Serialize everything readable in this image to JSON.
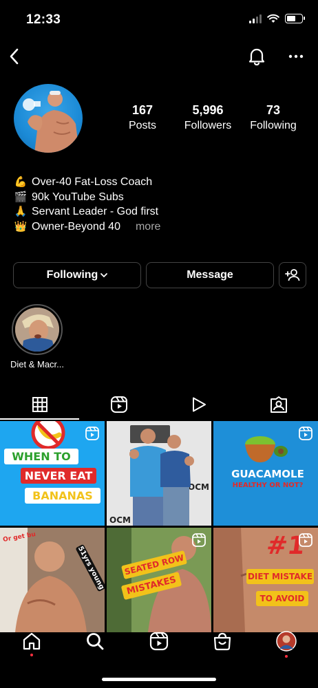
{
  "status_bar": {
    "time": "12:33"
  },
  "profile": {
    "stats": [
      {
        "value": "167",
        "label": "Posts"
      },
      {
        "value": "5,996",
        "label": "Followers"
      },
      {
        "value": "73",
        "label": "Following"
      }
    ],
    "bio": [
      {
        "emoji": "💪",
        "text": "Over-40 Fat-Loss Coach"
      },
      {
        "emoji": "🎬",
        "text": "90k YouTube Subs"
      },
      {
        "emoji": "🙏",
        "text": "Servant Leader - God first"
      },
      {
        "emoji": "👑",
        "text": "Owner-Beyond 40"
      }
    ],
    "more_label": "more"
  },
  "actions": {
    "following_label": "Following",
    "message_label": "Message"
  },
  "highlights": [
    {
      "label": "Diet & Macr..."
    }
  ],
  "tabs": [
    {
      "icon": "grid-icon"
    },
    {
      "icon": "reels-icon"
    },
    {
      "icon": "video-play-icon"
    },
    {
      "icon": "tagged-icon"
    }
  ],
  "grid": [
    {
      "caption_lines": [
        "WHEN TO",
        "NEVER EAT",
        "BANANAS"
      ],
      "reel": true
    },
    {
      "caption_lines": [],
      "reel": false
    },
    {
      "caption_lines": [
        "GUACAMOLE",
        "HEALTHY OR NOT?"
      ],
      "reel": true
    },
    {
      "caption_lines": [
        "51yrs young",
        "Or get bu"
      ],
      "reel": false
    },
    {
      "caption_lines": [
        "SEATED ROW",
        "MISTAKES"
      ],
      "reel": true
    },
    {
      "caption_lines": [
        "#1",
        "DIET MISTAKE",
        "TO AVOID"
      ],
      "reel": true
    }
  ],
  "bottom_nav": [
    {
      "icon": "home-icon"
    },
    {
      "icon": "search-icon"
    },
    {
      "icon": "reels-icon"
    },
    {
      "icon": "shop-icon"
    },
    {
      "icon": "profile-avatar"
    }
  ],
  "colors": {
    "background": "#000000",
    "notification_dot": "#ff3040",
    "accent_blue": "#1b8ad6"
  }
}
